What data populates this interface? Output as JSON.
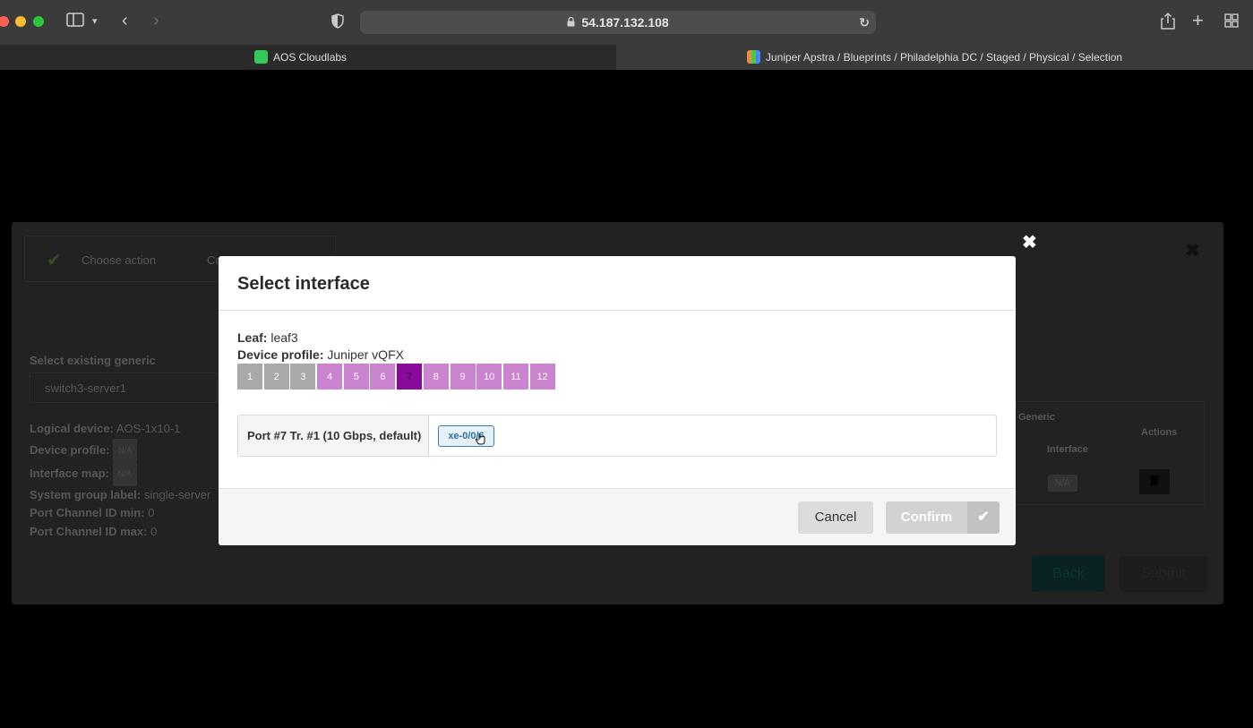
{
  "browser": {
    "address": "54.187.132.108",
    "tabs": [
      {
        "label": "AOS Cloudlabs"
      },
      {
        "label": "Juniper Apstra / Blueprints / Philadelphia DC / Staged / Physical / Selection"
      }
    ]
  },
  "background": {
    "step_choose_action": "Choose action",
    "step_second_partial": "Co",
    "select_generic_label": "Select existing generic",
    "select_generic_value": "switch3-server1",
    "logical_device_label": "Logical device:",
    "logical_device_value": "AOS-1x10-1",
    "device_profile_label": "Device profile:",
    "device_profile_value": "N/A",
    "interface_map_label": "Interface map:",
    "interface_map_value": "N/A",
    "system_group_label": "System group label:",
    "system_group_value": "single-server",
    "pc_min_label": "Port Channel ID min:",
    "pc_min_value": "0",
    "pc_max_label": "Port Channel ID max:",
    "pc_max_value": "0",
    "col_generic": "Generic",
    "col_interface": "Interface",
    "col_actions": "Actions",
    "cell_interface": "N/A",
    "back_button": "Back",
    "submit_button": "Submit"
  },
  "dialog": {
    "title": "Select interface",
    "leaf_label": "Leaf:",
    "leaf_value": "leaf3",
    "device_profile_label": "Device profile:",
    "device_profile_value": "Juniper vQFX",
    "ports": [
      {
        "num": "1",
        "state": "used"
      },
      {
        "num": "2",
        "state": "used"
      },
      {
        "num": "3",
        "state": "used"
      },
      {
        "num": "4",
        "state": "available"
      },
      {
        "num": "5",
        "state": "available"
      },
      {
        "num": "6",
        "state": "available"
      },
      {
        "num": "7",
        "state": "selected"
      },
      {
        "num": "8",
        "state": "available"
      },
      {
        "num": "9",
        "state": "available"
      },
      {
        "num": "10",
        "state": "available"
      },
      {
        "num": "11",
        "state": "available"
      },
      {
        "num": "12",
        "state": "available"
      }
    ],
    "port_row_label": "Port #7 Tr. #1 (10 Gbps, default)",
    "interface_chip": "xe-0/0/6",
    "cancel_label": "Cancel",
    "confirm_label": "Confirm"
  },
  "colors": {
    "port_used": "#a9a9a9",
    "port_available": "#c983cf",
    "port_selected": "#8a0b9b",
    "chip_border": "#3a7eb3"
  }
}
